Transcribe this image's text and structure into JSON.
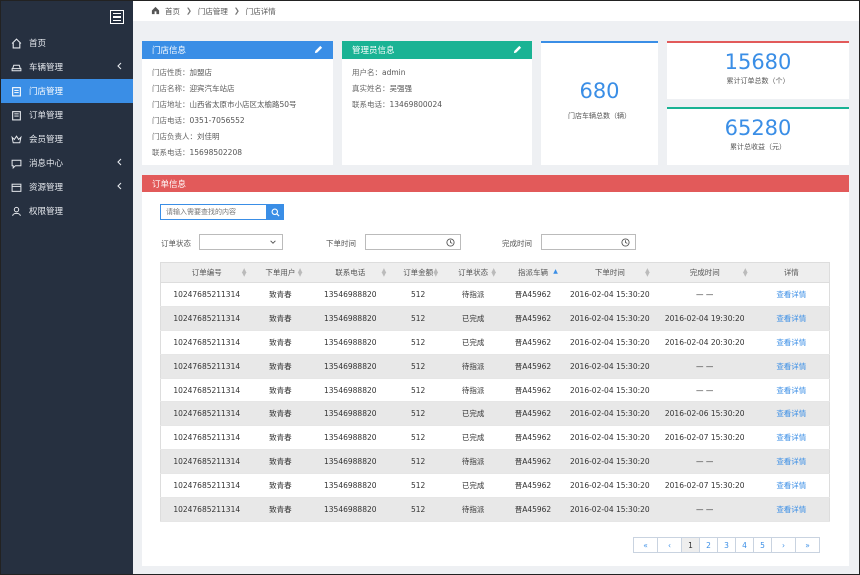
{
  "sidebar": {
    "items": [
      {
        "label": "首页",
        "icon": "home-icon",
        "active": false,
        "has_chevron": false
      },
      {
        "label": "车辆管理",
        "icon": "car-icon",
        "active": false,
        "has_chevron": true
      },
      {
        "label": "门店管理",
        "icon": "store-icon",
        "active": true,
        "has_chevron": false
      },
      {
        "label": "订单管理",
        "icon": "order-icon",
        "active": false,
        "has_chevron": false
      },
      {
        "label": "会员管理",
        "icon": "member-icon",
        "active": false,
        "has_chevron": false
      },
      {
        "label": "消息中心",
        "icon": "message-icon",
        "active": false,
        "has_chevron": true
      },
      {
        "label": "资源管理",
        "icon": "resource-icon",
        "active": false,
        "has_chevron": true
      },
      {
        "label": "权限管理",
        "icon": "user-icon",
        "active": false,
        "has_chevron": false
      }
    ]
  },
  "breadcrumb": [
    "首页",
    "门店管理",
    "门店详情"
  ],
  "store_info": {
    "title": "门店信息",
    "color": "#3a8ee6",
    "lines": [
      {
        "label": "门店性质：",
        "value": "加盟店"
      },
      {
        "label": "门店名称：",
        "value": "迎宾汽车站店"
      },
      {
        "label": "门店地址：",
        "value": "山西省太原市小店区太榆路50号"
      },
      {
        "label": "门店电话：",
        "value": "0351-7056552"
      },
      {
        "label": "门店负责人：",
        "value": "刘佳明"
      },
      {
        "label": "联系电话：",
        "value": "15698502208"
      }
    ]
  },
  "admin_info": {
    "title": "管理员信息",
    "color": "#1ab394",
    "lines": [
      {
        "label": "用户名：",
        "value": "admin"
      },
      {
        "label": "真实姓名：",
        "value": "吴强强"
      },
      {
        "label": "联系电话：",
        "value": "13469800024"
      }
    ]
  },
  "stats": {
    "vehicles": {
      "value": "680",
      "label": "门店车辆总数（辆）",
      "color": "#3a8ee6"
    },
    "orders": {
      "value": "15680",
      "label": "累计订单总数（个）",
      "color": "#e25a5a"
    },
    "revenue": {
      "value": "65280",
      "label": "累计总收益（元）",
      "color": "#1ab394"
    }
  },
  "orders": {
    "title": "订单信息",
    "search_placeholder": "请输入需要查找的内容",
    "filters": {
      "status_label": "订单状态",
      "order_time_label": "下单时间",
      "finish_time_label": "完成时间"
    },
    "columns": [
      "订单编号",
      "下单用户",
      "联系电话",
      "订单金额",
      "订单状态",
      "指派车辆",
      "下单时间",
      "完成时间",
      "详情"
    ],
    "rows": [
      [
        "10247685211314",
        "致青春",
        "13546988820",
        "512",
        "待指派",
        "晋A45962",
        "2016-02-04 15:30:20",
        "— —",
        "查看详情"
      ],
      [
        "10247685211314",
        "致青春",
        "13546988820",
        "512",
        "已完成",
        "晋A45962",
        "2016-02-04 15:30:20",
        "2016-02-04 19:30:20",
        "查看详情"
      ],
      [
        "10247685211314",
        "致青春",
        "13546988820",
        "512",
        "已完成",
        "晋A45962",
        "2016-02-04 15:30:20",
        "2016-02-04 20:30:20",
        "查看详情"
      ],
      [
        "10247685211314",
        "致青春",
        "13546988820",
        "512",
        "待指派",
        "晋A45962",
        "2016-02-04 15:30:20",
        "— —",
        "查看详情"
      ],
      [
        "10247685211314",
        "致青春",
        "13546988820",
        "512",
        "待指派",
        "晋A45962",
        "2016-02-04 15:30:20",
        "— —",
        "查看详情"
      ],
      [
        "10247685211314",
        "致青春",
        "13546988820",
        "512",
        "已完成",
        "晋A45962",
        "2016-02-04 15:30:20",
        "2016-02-06 15:30:20",
        "查看详情"
      ],
      [
        "10247685211314",
        "致青春",
        "13546988820",
        "512",
        "已完成",
        "晋A45962",
        "2016-02-04 15:30:20",
        "2016-02-07 15:30:20",
        "查看详情"
      ],
      [
        "10247685211314",
        "致青春",
        "13546988820",
        "512",
        "待指派",
        "晋A45962",
        "2016-02-04 15:30:20",
        "— —",
        "查看详情"
      ],
      [
        "10247685211314",
        "致青春",
        "13546988820",
        "512",
        "已完成",
        "晋A45962",
        "2016-02-04 15:30:20",
        "2016-02-07 15:30:20",
        "查看详情"
      ],
      [
        "10247685211314",
        "致青春",
        "13546988820",
        "512",
        "待指派",
        "晋A45962",
        "2016-02-04 15:30:20",
        "— —",
        "查看详情"
      ]
    ]
  },
  "pagination": {
    "first": "«",
    "prev": "‹",
    "pages": [
      "1",
      "2",
      "3",
      "4",
      "5"
    ],
    "current": "1",
    "next": "›",
    "last": "»"
  }
}
